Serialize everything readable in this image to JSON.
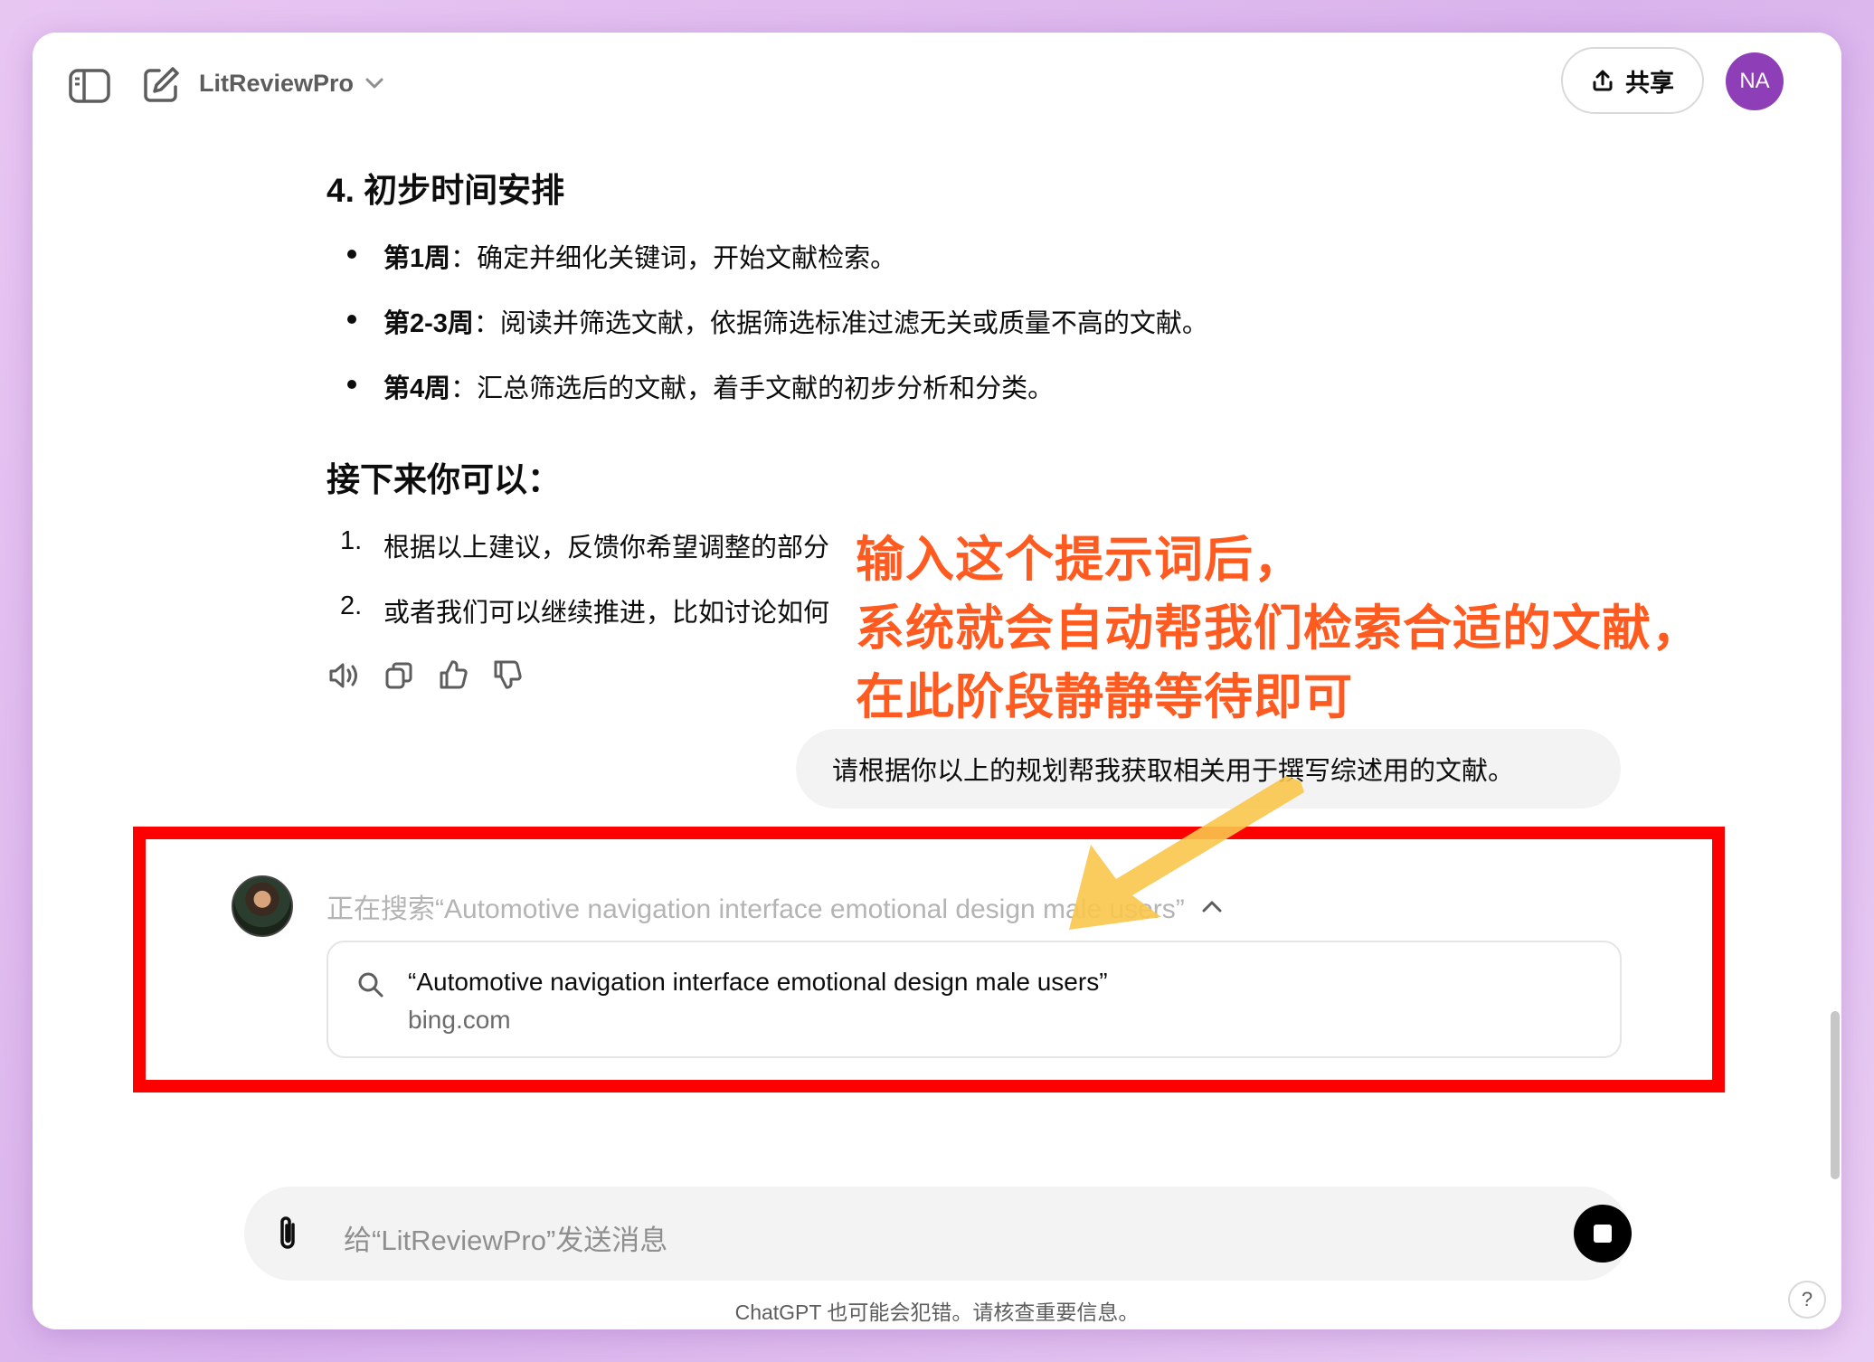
{
  "header": {
    "title": "LitReviewPro",
    "share_label": "共享",
    "avatar_initials": "NA"
  },
  "assistant": {
    "section4_heading": "4. 初步时间安排",
    "timeline": [
      {
        "bold": "第1周",
        "text": "：确定并细化关键词，开始文献检索。"
      },
      {
        "bold": "第2-3周",
        "text": "：阅读并筛选文献，依据筛选标准过滤无关或质量不高的文献。"
      },
      {
        "bold": "第4周",
        "text": "：汇总筛选后的文献，着手文献的初步分析和分类。"
      }
    ],
    "next_heading": "接下来你可以：",
    "next_items": [
      {
        "num": "1.",
        "text": "根据以上建议，反馈你希望调整的部分"
      },
      {
        "num": "2.",
        "text": "或者我们可以继续推进，比如讨论如何"
      }
    ]
  },
  "annotation": {
    "lines": [
      "输入这个提示词后，",
      "系统就会自动帮我们检索合适的文献，",
      "在此阶段静静等待即可"
    ]
  },
  "user_message": "请根据你以上的规划帮我获取相关用于撰写综述用的文献。",
  "search": {
    "status": "正在搜索“Automotive navigation interface emotional design male users”",
    "result_title": "“Automotive navigation interface emotional design male users”",
    "result_source": "bing.com"
  },
  "composer": {
    "placeholder": "给“LitReviewPro”发送消息"
  },
  "footer": {
    "disclaimer": "ChatGPT 也可能会犯错。请核查重要信息。",
    "help": "?"
  }
}
